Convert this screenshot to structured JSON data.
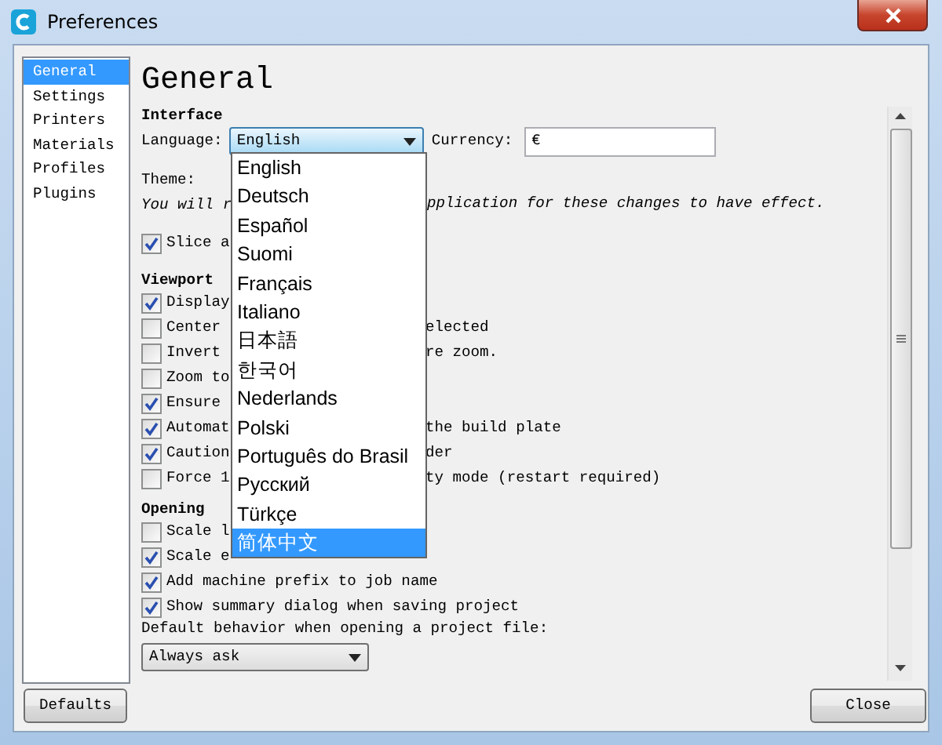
{
  "window": {
    "title": "Preferences"
  },
  "sidebar": {
    "items": [
      {
        "label": "General",
        "selected": true
      },
      {
        "label": "Settings",
        "selected": false
      },
      {
        "label": "Printers",
        "selected": false
      },
      {
        "label": "Materials",
        "selected": false
      },
      {
        "label": "Profiles",
        "selected": false
      },
      {
        "label": "Plugins",
        "selected": false
      }
    ]
  },
  "page": {
    "heading": "General"
  },
  "interface": {
    "title": "Interface",
    "language_label": "Language:",
    "language_value": "English",
    "currency_label": "Currency:",
    "currency_value": "€",
    "theme_label": "Theme:",
    "note_left": "You will r",
    "note_right": "pplication for these changes to have effect.",
    "options": [
      {
        "label": "Slice a",
        "checked": true
      }
    ]
  },
  "viewport": {
    "title": "Viewport",
    "options": [
      {
        "label": "Display",
        "checked": true
      },
      {
        "label": "Center",
        "label_right": "elected",
        "checked": false
      },
      {
        "label": "Invert",
        "label_right": "re zoom.",
        "checked": false
      },
      {
        "label": "Zoom to",
        "checked": false
      },
      {
        "label": "Ensure",
        "checked": true
      },
      {
        "label": "Automat",
        "label_right": "the build plate",
        "checked": true
      },
      {
        "label": "Caution",
        "label_right": "der",
        "checked": true
      },
      {
        "label": "Force 1",
        "label_right": "ty mode (restart required)",
        "checked": false
      }
    ]
  },
  "opening": {
    "title": "Opening",
    "options": [
      {
        "label": "Scale l",
        "checked": false
      },
      {
        "label": "Scale e",
        "checked": true
      },
      {
        "label": "Add machine prefix to job name",
        "checked": true
      },
      {
        "label": "Show summary dialog when saving project",
        "checked": true
      }
    ],
    "default_label": "Default behavior when opening a project file:",
    "default_value": "Always ask"
  },
  "language_dropdown": {
    "options": [
      {
        "label": "English",
        "selected": false
      },
      {
        "label": "Deutsch",
        "selected": false
      },
      {
        "label": "Español",
        "selected": false
      },
      {
        "label": "Suomi",
        "selected": false
      },
      {
        "label": "Français",
        "selected": false
      },
      {
        "label": "Italiano",
        "selected": false
      },
      {
        "label": "日本語",
        "selected": false
      },
      {
        "label": "한국어",
        "selected": false
      },
      {
        "label": "Nederlands",
        "selected": false
      },
      {
        "label": "Polski",
        "selected": false
      },
      {
        "label": "Português do Brasil",
        "selected": false
      },
      {
        "label": "Русский",
        "selected": false
      },
      {
        "label": "Türkçe",
        "selected": false
      },
      {
        "label": "简体中文",
        "selected": true
      }
    ]
  },
  "buttons": {
    "defaults": "Defaults",
    "close": "Close"
  }
}
